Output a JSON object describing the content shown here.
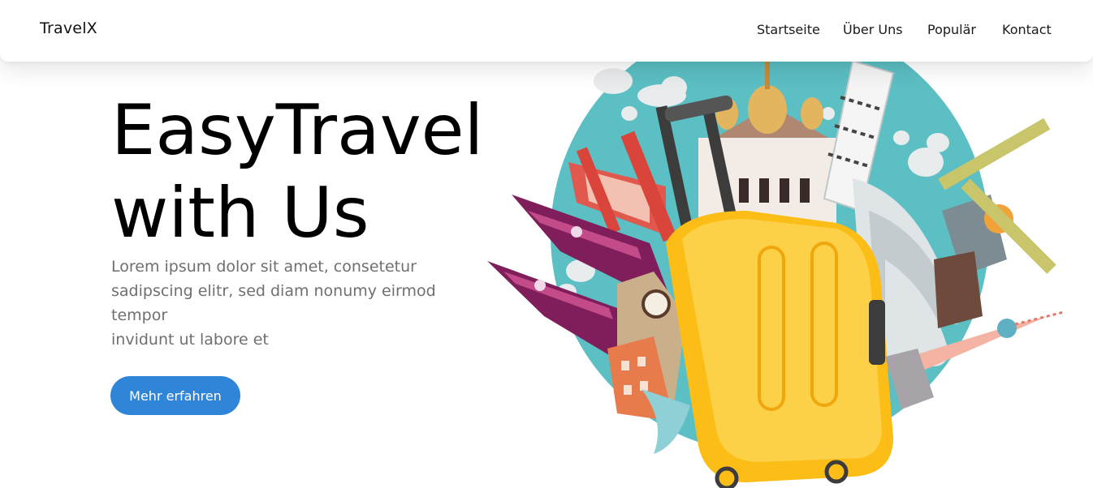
{
  "brand": "TravelX",
  "nav": {
    "items": [
      {
        "label": "Startseite"
      },
      {
        "label": "Über Uns"
      },
      {
        "label": "Populär"
      },
      {
        "label": "Kontact"
      }
    ]
  },
  "hero": {
    "title_line1": "EasyTravel",
    "title_line2": "with Us",
    "text_lines": [
      "Lorem ipsum dolor sit amet, consetetur",
      "sadipscing elitr, sed diam nonumy eirmod",
      "tempor",
      "invidunt ut labore et"
    ],
    "cta_label": "Mehr erfahren"
  },
  "colors": {
    "accent": "#2f86d9",
    "globe": "#5bbfc4",
    "suitcase": "#fbbd16"
  },
  "illustration": {
    "icon": "travel-suitcase-landmarks-illustration"
  }
}
